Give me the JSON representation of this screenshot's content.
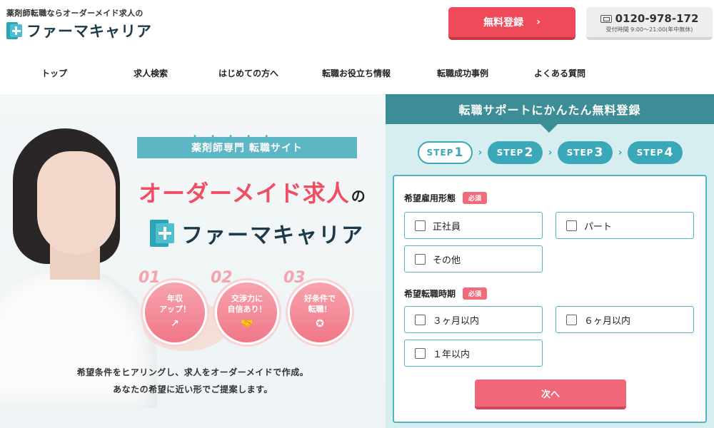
{
  "header": {
    "tagline": "薬剤師転職ならオーダーメイド求人の",
    "logo_text": "ファーマキャリア",
    "register_button": "無料登録",
    "register_chevron": "›",
    "phone_number": "0120-978-172",
    "phone_hours": "受付時間 9:00～21:00(年中無休)"
  },
  "nav": {
    "items": [
      {
        "label": "トップ"
      },
      {
        "label": "求人検索"
      },
      {
        "label": "はじめての方へ"
      },
      {
        "label": "転職お役立ち情報"
      },
      {
        "label": "転職成功事例"
      },
      {
        "label": "よくある質問"
      }
    ]
  },
  "hero": {
    "dots": "• • • • •",
    "tagline": "薬剤師専門 転職サイト",
    "headline": "オーダーメイド求人",
    "headline_suffix": "の",
    "logo_text": "ファーマキャリア",
    "badges": [
      {
        "num": "01",
        "line1": "年収",
        "line2": "アップ！",
        "icon": "chart-up-icon"
      },
      {
        "num": "02",
        "line1": "交渉力に",
        "line2": "自信あり！",
        "icon": "handshake-icon"
      },
      {
        "num": "03",
        "line1": "好条件で",
        "line2": "転職！",
        "icon": "award-icon"
      }
    ],
    "copy_line1": "希望条件をヒアリングし、求人をオーダーメイドで作成。",
    "copy_line2": "あなたの希望に近い形でご提案します。"
  },
  "form_panel": {
    "title": "転職サポートにかんたん無料登録",
    "steps": [
      {
        "label": "STEP",
        "num": "1",
        "active": true
      },
      {
        "label": "STEP",
        "num": "2",
        "active": false
      },
      {
        "label": "STEP",
        "num": "3",
        "active": false
      },
      {
        "label": "STEP",
        "num": "4",
        "active": false
      }
    ],
    "step_arrow": "›",
    "required_label": "必須",
    "employment": {
      "label": "希望雇用形態",
      "options": [
        "正社員",
        "パート",
        "その他"
      ]
    },
    "timing": {
      "label": "希望転職時期",
      "options": [
        "３ヶ月以内",
        "６ヶ月以内",
        "１年以内"
      ]
    },
    "next_button": "次へ"
  },
  "colors": {
    "accent_red": "#ef4a5a",
    "teal": "#3c8d96",
    "light_teal": "#d7eef1",
    "pink": "#f0677a"
  }
}
